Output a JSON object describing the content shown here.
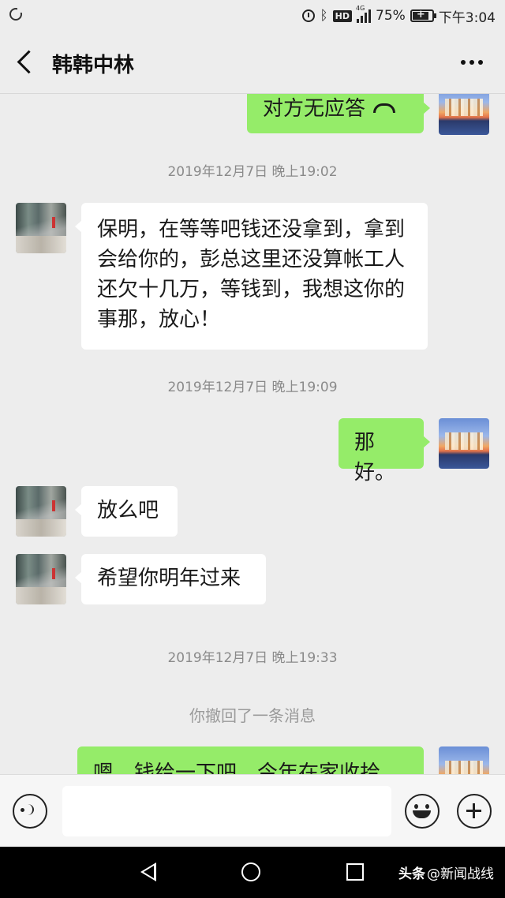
{
  "status_bar": {
    "battery_percent": "75%",
    "time": "下午3:04",
    "hd_label": "HD",
    "network_label": "4G",
    "icons": [
      "sync-icon",
      "alarm-icon",
      "bluetooth-icon",
      "hd-icon",
      "signal-icon",
      "battery-icon"
    ]
  },
  "header": {
    "title": "韩韩中林",
    "back_icon": "chevron-left-icon",
    "more_icon": "more-dots-icon"
  },
  "messages": [
    {
      "type": "outgoing",
      "text": "对方无应答",
      "icon": "hangup-icon"
    },
    {
      "type": "timestamp",
      "text": "2019年12月7日 晚上19:02"
    },
    {
      "type": "incoming",
      "text": "保明，在等等吧钱还没拿到，拿到会给你的，彭总这里还没算帐工人还欠十几万，等钱到，我想这你的事那，放心！"
    },
    {
      "type": "timestamp",
      "text": "2019年12月7日 晚上19:09"
    },
    {
      "type": "outgoing",
      "text": "那好。"
    },
    {
      "type": "incoming",
      "text": "放么吧"
    },
    {
      "type": "incoming",
      "text": "希望你明年过来"
    },
    {
      "type": "timestamp",
      "text": "2019年12月7日 晚上19:33"
    },
    {
      "type": "system",
      "text": "你撤回了一条消息"
    },
    {
      "type": "outgoing",
      "text": "嗯，钱给一下吧，今年在家收拾"
    }
  ],
  "input_bar": {
    "voice_icon": "voice-icon",
    "emoji_icon": "emoji-icon",
    "plus_icon": "plus-icon",
    "input_value": ""
  },
  "nav_bar": {
    "watermark_brand": "头条",
    "watermark_handle": "@新闻战线"
  },
  "colors": {
    "background": "#ededed",
    "outgoing_bubble": "#95ec69",
    "incoming_bubble": "#ffffff",
    "timestamp_text": "#8a8a8a"
  }
}
